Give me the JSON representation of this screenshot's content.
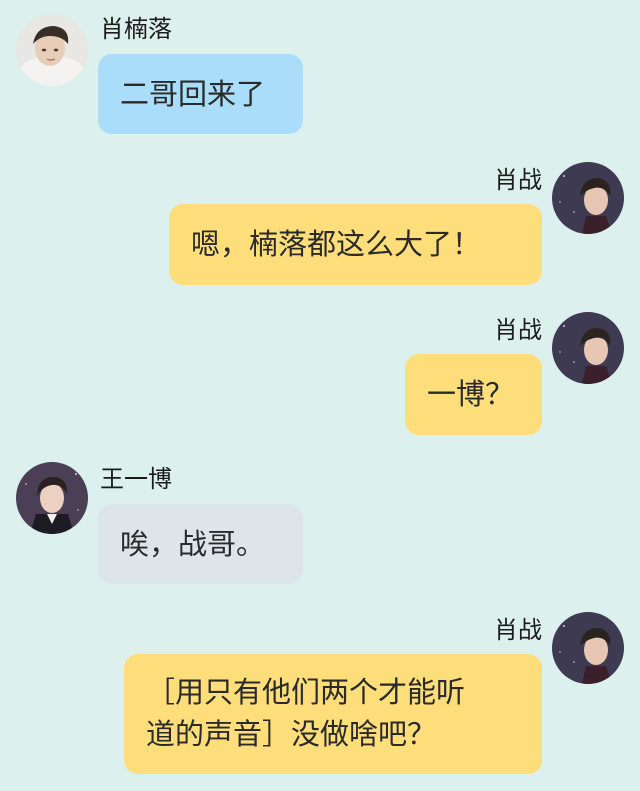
{
  "messages": [
    {
      "sender": "肖楠落",
      "text": "二哥回来了",
      "side": "left",
      "color": "blue",
      "avatar": "avatar-xiao-nanluo"
    },
    {
      "sender": "肖战",
      "text": "嗯，楠落都这么大了！",
      "side": "right",
      "color": "yellow",
      "avatar": "avatar-xiao-zhan"
    },
    {
      "sender": "肖战",
      "text": "一博？",
      "side": "right",
      "color": "yellow",
      "avatar": "avatar-xiao-zhan"
    },
    {
      "sender": "王一博",
      "text": "唉，战哥。",
      "side": "left",
      "color": "gray",
      "avatar": "avatar-wang-yibo"
    },
    {
      "sender": "肖战",
      "text": "［用只有他们两个才能听\n道的声音］没做啥吧？",
      "side": "right",
      "color": "yellow",
      "avatar": "avatar-xiao-zhan"
    }
  ],
  "colors": {
    "background": "#dcf0ee",
    "bubble_blue": "#a9ddf9",
    "bubble_yellow": "#fede7b",
    "bubble_gray": "#dde5ea"
  }
}
